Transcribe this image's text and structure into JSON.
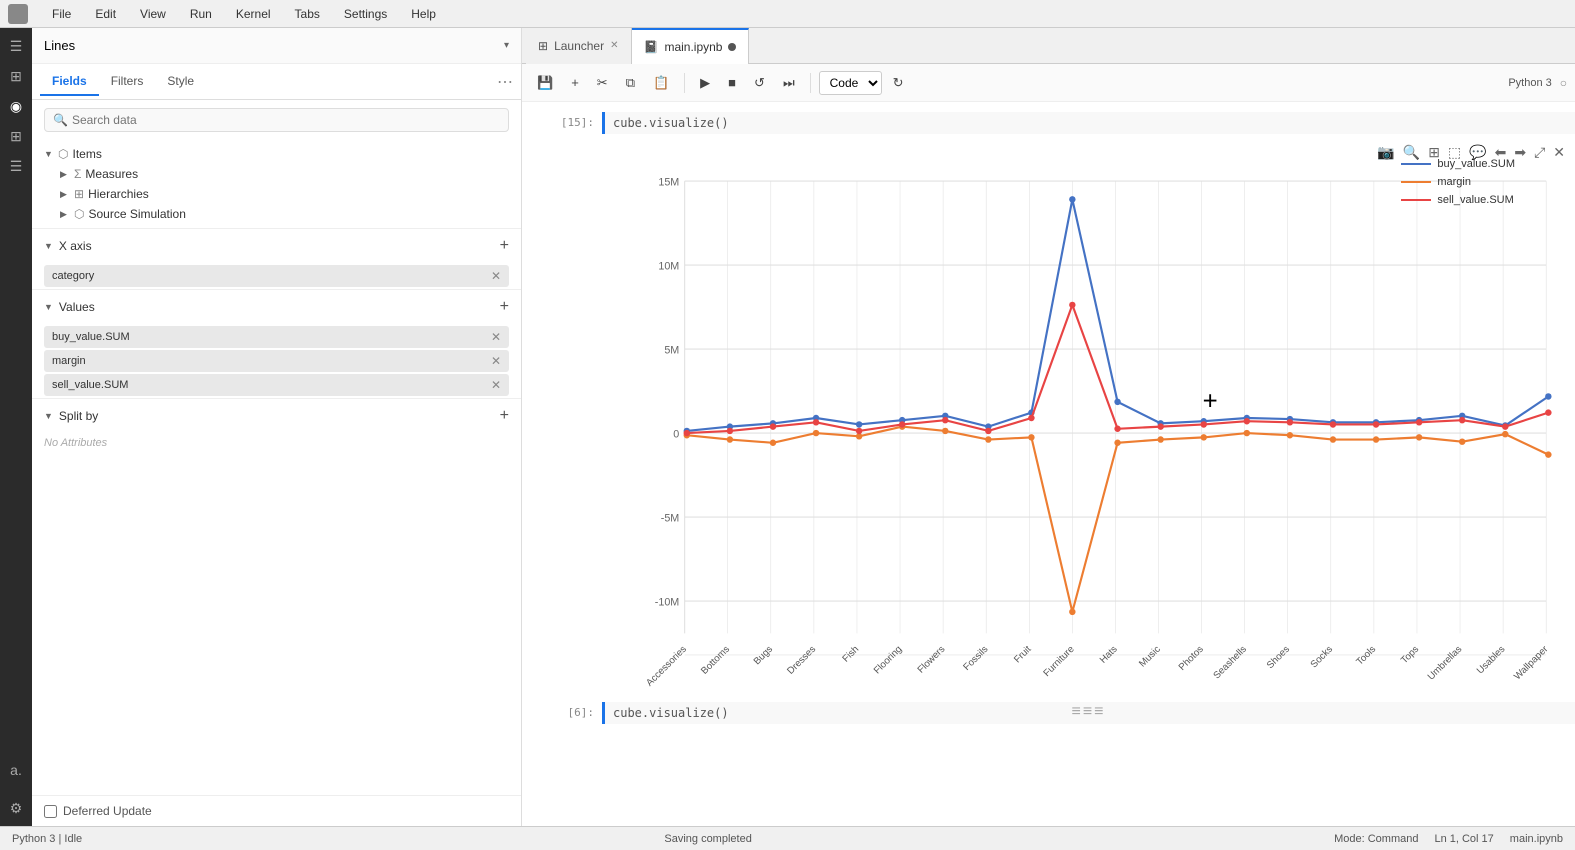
{
  "menubar": {
    "items": [
      "File",
      "Edit",
      "View",
      "Run",
      "Kernel",
      "Tabs",
      "Settings",
      "Help"
    ]
  },
  "tabs": {
    "launcher": {
      "label": "Launcher",
      "active": false
    },
    "notebook": {
      "label": "main.ipynb",
      "active": true
    }
  },
  "toolbar": {
    "code_label": "Code",
    "buttons": [
      "save",
      "add",
      "cut",
      "copy",
      "paste",
      "run",
      "stop",
      "restart",
      "skip",
      "refresh"
    ]
  },
  "panel": {
    "header": "Lines",
    "tabs": [
      "Fields",
      "Filters",
      "Style"
    ],
    "active_tab": "Fields",
    "search_placeholder": "Search data",
    "tree": {
      "root": "Items",
      "children": [
        "Measures",
        "Hierarchies",
        "Source Simulation"
      ]
    },
    "x_axis": {
      "label": "X axis",
      "tag": "category"
    },
    "values": {
      "label": "Values",
      "tags": [
        "buy_value.SUM",
        "margin",
        "sell_value.SUM"
      ]
    },
    "split_by": {
      "label": "Split by",
      "no_attr": "No Attributes"
    },
    "deferred": "Deferred Update"
  },
  "chart": {
    "cell_in_label": "[15]:",
    "cell_in_code": "cube.visualize()",
    "cell_out_label": "",
    "cell_in2_label": "[6]:",
    "cell_in2_code": "cube.visualize()",
    "y_labels": [
      "15M",
      "10M",
      "5M",
      "0",
      "-5M",
      "-10M"
    ],
    "x_labels": [
      "Accessories",
      "Bottoms",
      "Bugs",
      "Dresses",
      "Fish",
      "Flooring",
      "Flowers",
      "Fossils",
      "Fruit",
      "Furniture",
      "Hats",
      "Music",
      "Photos",
      "Seashells",
      "Shoes",
      "Socks",
      "Tools",
      "Tops",
      "Umbrellas",
      "Usables",
      "Wallpaper"
    ],
    "legend": [
      {
        "name": "buy_value.SUM",
        "color": "#4472C4"
      },
      {
        "name": "margin",
        "color": "#ED7D31"
      },
      {
        "name": "sell_value.SUM",
        "color": "#E84444"
      }
    ]
  },
  "status": {
    "left": "Python 3 | Idle",
    "center": "Saving completed",
    "mode": "Mode: Command",
    "location": "Ln 1, Col 17",
    "file": "main.ipynb"
  },
  "python_version": "Python 3"
}
